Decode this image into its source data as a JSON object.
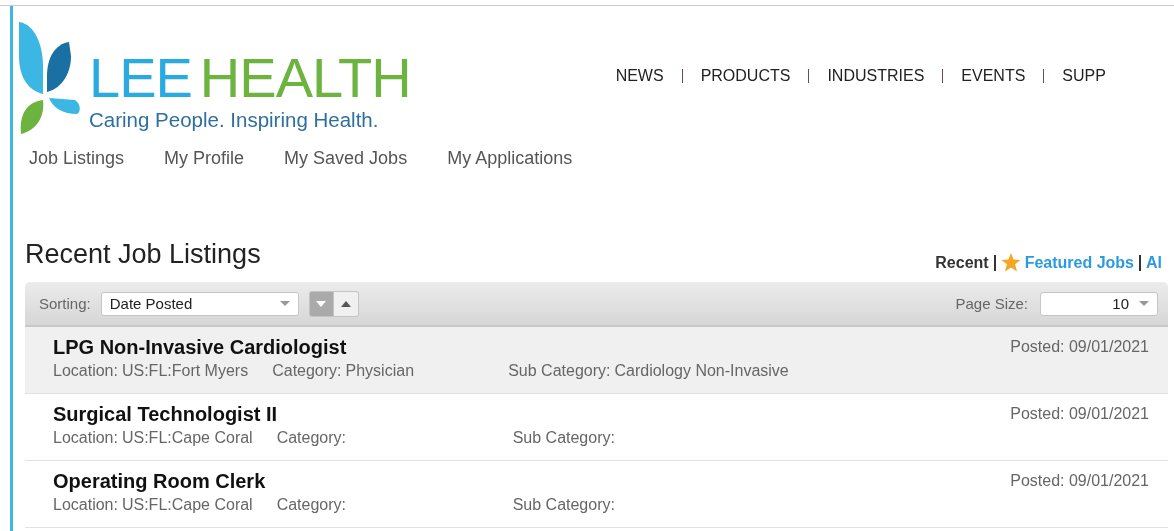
{
  "logo": {
    "name_first": "LEE",
    "name_second": "HEALTH",
    "tagline": "Caring People. Inspiring Health."
  },
  "top_nav": [
    "NEWS",
    "PRODUCTS",
    "INDUSTRIES",
    "EVENTS",
    "SUPP"
  ],
  "tabs": [
    {
      "label": "Job Listings"
    },
    {
      "label": "My Profile"
    },
    {
      "label": "My Saved Jobs"
    },
    {
      "label": "My Applications"
    }
  ],
  "heading": "Recent Job Listings",
  "view_links": [
    {
      "label": "Recent",
      "selected": true,
      "starred": false
    },
    {
      "label": "Featured Jobs",
      "selected": false,
      "starred": true
    },
    {
      "label": "Al",
      "selected": false,
      "starred": false
    }
  ],
  "toolbar": {
    "sorting_label": "Sorting:",
    "sorting_value": "Date Posted",
    "sort_descending": true,
    "page_size_label": "Page Size:",
    "page_size_value": "10"
  },
  "jobs": [
    {
      "title": "LPG Non-Invasive Cardiologist",
      "location_label": "Location:",
      "location": "US:FL:Fort Myers",
      "category_label": "Category:",
      "category": "Physician",
      "sub_category_label": "Sub Category:",
      "sub_category": "Cardiology Non-Invasive",
      "posted": "Posted: 09/01/2021",
      "selected": true
    },
    {
      "title": "Surgical Technologist II",
      "location_label": "Location:",
      "location": "US:FL:Cape Coral",
      "category_label": "Category:",
      "sub_category_label": "Sub Category:",
      "posted": "Posted: 09/01/2021",
      "selected": false
    },
    {
      "title": "Operating Room Clerk",
      "location_label": "Location:",
      "location": "US:FL:Cape Coral",
      "category_label": "Category:",
      "sub_category_label": "Sub Category:",
      "posted": "Posted: 09/01/2021",
      "selected": false
    }
  ]
}
